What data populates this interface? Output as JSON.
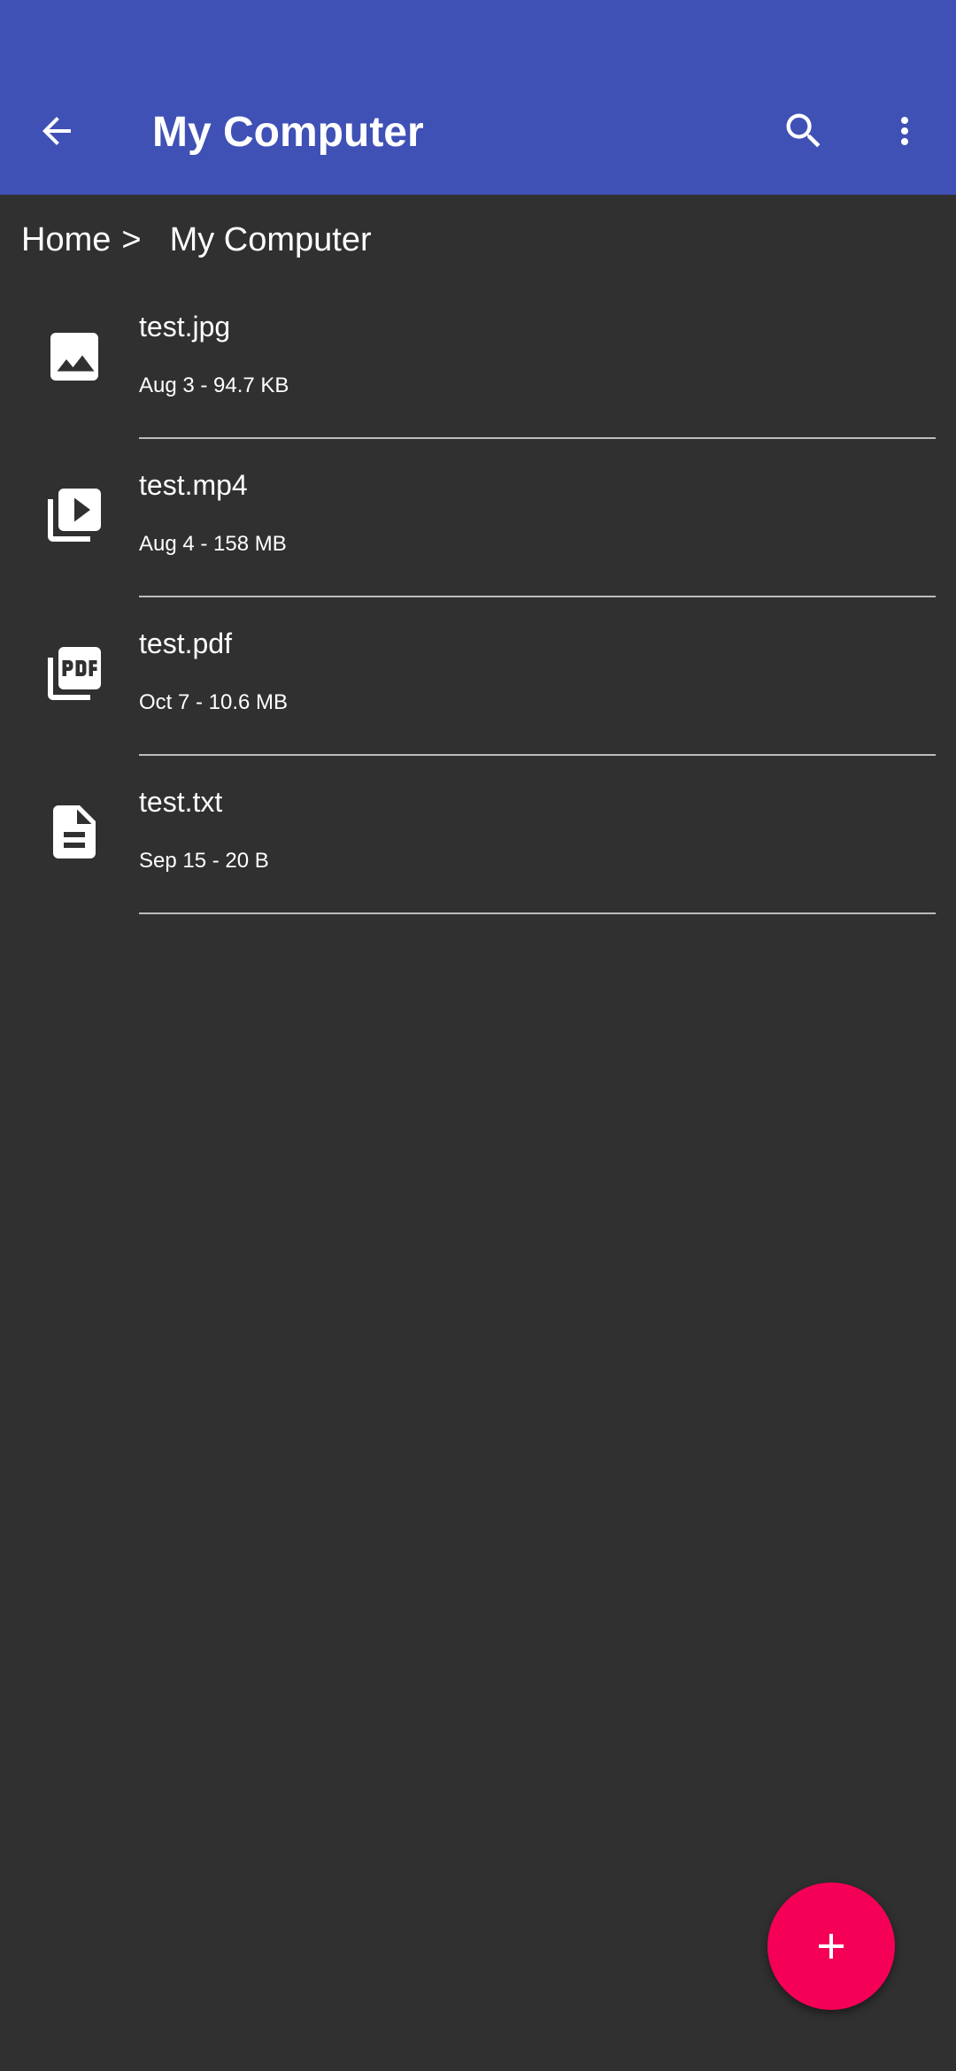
{
  "app_bar": {
    "title": "My Computer",
    "color": "#3f51b5",
    "back_icon": "arrow-back-icon",
    "search_icon": "search-icon",
    "more_icon": "more-vert-icon"
  },
  "breadcrumb": {
    "home": "Home",
    "separator": ">",
    "current": "My Computer"
  },
  "files": [
    {
      "name": "test.jpg",
      "meta": "Aug 3 - 94.7 KB",
      "icon": "image-icon"
    },
    {
      "name": "test.mp4",
      "meta": "Aug 4 - 158 MB",
      "icon": "video-library-icon"
    },
    {
      "name": "test.pdf",
      "meta": "Oct 7 - 10.6 MB",
      "icon": "pdf-icon"
    },
    {
      "name": "test.txt",
      "meta": "Sep 15 - 20 B",
      "icon": "document-icon"
    }
  ],
  "fab": {
    "icon": "add-icon",
    "color": "#f50057"
  },
  "colors": {
    "background": "#303030",
    "divider": "#bdbdbd",
    "text": "#ffffff"
  }
}
